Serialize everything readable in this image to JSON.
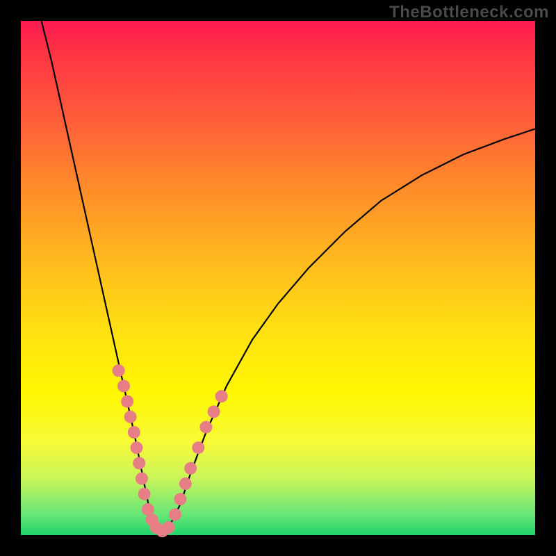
{
  "watermark": "TheBottleneck.com",
  "chart_data": {
    "type": "line",
    "title": "",
    "xlabel": "",
    "ylabel": "",
    "xlim": [
      0,
      100
    ],
    "ylim": [
      0,
      100
    ],
    "curve": {
      "x": [
        4,
        6,
        8,
        10,
        12,
        14,
        16,
        18,
        20,
        22,
        23,
        24,
        25,
        26,
        27.5,
        29,
        31,
        33,
        36,
        40,
        45,
        50,
        56,
        63,
        70,
        78,
        86,
        94,
        100
      ],
      "y": [
        100,
        92,
        83,
        74,
        65,
        56,
        47,
        38,
        29,
        20,
        15,
        10,
        5,
        2,
        0.5,
        2,
        6,
        12,
        20,
        29,
        38,
        45,
        52,
        59,
        65,
        70,
        74,
        77,
        79
      ]
    },
    "markers": {
      "left_branch": [
        {
          "x": 19,
          "y": 32
        },
        {
          "x": 20,
          "y": 29
        },
        {
          "x": 20.7,
          "y": 26
        },
        {
          "x": 21.3,
          "y": 23
        },
        {
          "x": 22,
          "y": 20
        },
        {
          "x": 22.5,
          "y": 17
        },
        {
          "x": 23,
          "y": 14
        },
        {
          "x": 23.5,
          "y": 11
        },
        {
          "x": 24,
          "y": 8
        },
        {
          "x": 24.7,
          "y": 5
        },
        {
          "x": 25.5,
          "y": 3
        }
      ],
      "bottom": [
        {
          "x": 26.3,
          "y": 1.5
        },
        {
          "x": 27.5,
          "y": 0.8
        },
        {
          "x": 28.7,
          "y": 1.5
        }
      ],
      "right_branch": [
        {
          "x": 30,
          "y": 4
        },
        {
          "x": 31,
          "y": 7
        },
        {
          "x": 32,
          "y": 10
        },
        {
          "x": 33,
          "y": 13
        },
        {
          "x": 34.5,
          "y": 17
        },
        {
          "x": 36,
          "y": 21
        },
        {
          "x": 37.5,
          "y": 24
        },
        {
          "x": 39,
          "y": 27
        }
      ]
    },
    "marker_color": "#e77e86",
    "curve_color": "#000000"
  }
}
